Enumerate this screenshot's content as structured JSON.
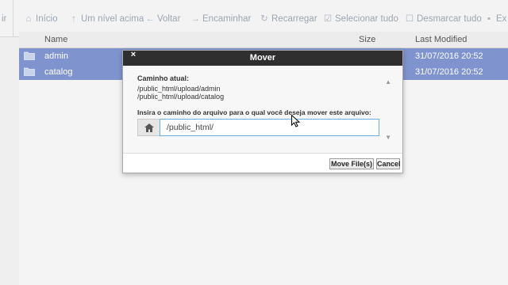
{
  "toolbar": {
    "partial_left": "ir",
    "home": "Início",
    "up": "Um nível acima",
    "back": "Voltar",
    "forward": "Encaminhar",
    "reload": "Recarregar",
    "select_all": "Selecionar tudo",
    "unselect_all": "Desmarcar tudo",
    "partial_right": "Ex"
  },
  "table": {
    "headers": {
      "name": "Name",
      "size": "Size",
      "last_modified": "Last Modified"
    },
    "rows": [
      {
        "name": "admin",
        "date": "31/07/2016 20:52"
      },
      {
        "name": "catalog",
        "date": "31/07/2016 20:52"
      }
    ]
  },
  "dialog": {
    "title": "Mover",
    "close": "×",
    "current_label": "Caminho atual:",
    "current_paths": [
      "/public_html/upload/admin",
      "/public_html/upload/catalog"
    ],
    "prompt": "Insira o caminho do arquivo para o qual você deseja mover este arquivo:",
    "path_value": "/public_html/",
    "move_button": "Move File(s)",
    "cancel_button": "Cancel"
  },
  "colors": {
    "selected_row": "#7f93cf",
    "dialog_header": "#2f2f2f",
    "focus_border": "#66afe9"
  },
  "icons": [
    "home-icon",
    "arrow-up-icon",
    "arrow-left-icon",
    "arrow-right-icon",
    "refresh-icon",
    "check-square-icon",
    "square-icon",
    "folder-icon",
    "house-icon",
    "mouse-cursor-icon"
  ]
}
